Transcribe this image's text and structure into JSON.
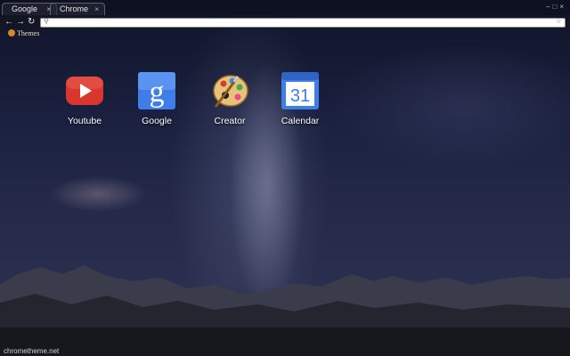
{
  "tabs": [
    {
      "label": "Google",
      "close": "×"
    },
    {
      "label": "Chrome",
      "close": "×"
    }
  ],
  "nav": {
    "back": "←",
    "forward": "→",
    "reload": "↻"
  },
  "omnibox": {
    "value": "",
    "search_icon": "search-icon",
    "star_icon": "star-icon"
  },
  "bookmarks": [
    {
      "label": "Themes",
      "icon": "themes-icon"
    }
  ],
  "apps": [
    {
      "label": "Youtube",
      "icon": "youtube-icon",
      "color": "#d9372e"
    },
    {
      "label": "Google",
      "icon": "google-icon",
      "glyph": "g",
      "color": "#3f7ee8"
    },
    {
      "label": "Creator",
      "icon": "palette-icon",
      "color": "#d9a441"
    },
    {
      "label": "Calendar",
      "icon": "calendar-icon",
      "glyph": "31",
      "color": "#3f7ee8"
    }
  ],
  "footer": "chrometheme.net"
}
